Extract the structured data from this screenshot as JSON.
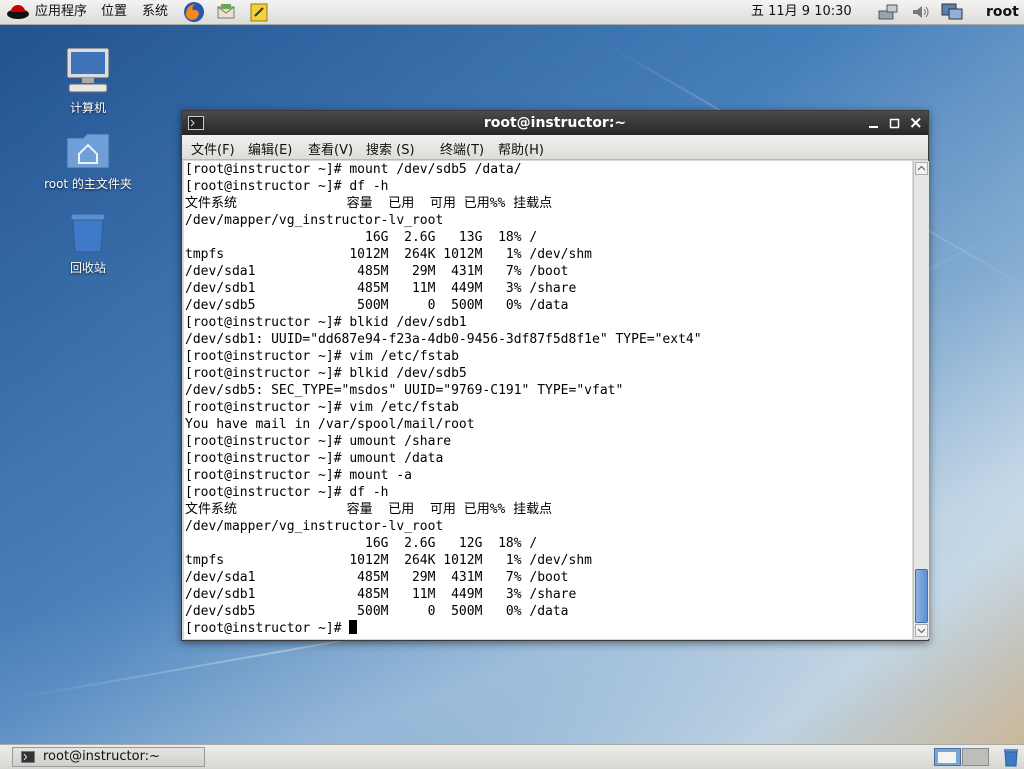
{
  "top_panel": {
    "applications": "应用程序",
    "places": "位置",
    "system": "系统",
    "clock": "五 11月  9 10:30",
    "user": "root"
  },
  "desktop": {
    "icons": [
      {
        "label": "计算机",
        "icon": "computer-icon"
      },
      {
        "label": "root 的主文件夹",
        "icon": "home-folder-icon"
      },
      {
        "label": "回收站",
        "icon": "trash-icon"
      }
    ]
  },
  "terminal": {
    "title": "root@instructor:~",
    "menu": [
      "文件(F)",
      "编辑(E)",
      "查看(V)",
      "搜索 (S)",
      "终端(T)",
      "帮助(H)"
    ],
    "lines": [
      "[root@instructor ~]# mount /dev/sdb5 /data/",
      "[root@instructor ~]# df -h",
      "文件系统              容量  已用  可用 已用%% 挂载点",
      "/dev/mapper/vg_instructor-lv_root",
      "                       16G  2.6G   13G  18% /",
      "tmpfs                1012M  264K 1012M   1% /dev/shm",
      "/dev/sda1             485M   29M  431M   7% /boot",
      "/dev/sdb1             485M   11M  449M   3% /share",
      "/dev/sdb5             500M     0  500M   0% /data",
      "[root@instructor ~]# blkid /dev/sdb1",
      "/dev/sdb1: UUID=\"dd687e94-f23a-4db0-9456-3df87f5d8f1e\" TYPE=\"ext4\"",
      "[root@instructor ~]# vim /etc/fstab",
      "[root@instructor ~]# blkid /dev/sdb5",
      "/dev/sdb5: SEC_TYPE=\"msdos\" UUID=\"9769-C191\" TYPE=\"vfat\"",
      "[root@instructor ~]# vim /etc/fstab",
      "You have mail in /var/spool/mail/root",
      "[root@instructor ~]# umount /share",
      "[root@instructor ~]# umount /data",
      "[root@instructor ~]# mount -a",
      "[root@instructor ~]# df -h",
      "文件系统              容量  已用  可用 已用%% 挂载点",
      "/dev/mapper/vg_instructor-lv_root",
      "                       16G  2.6G   12G  18% /",
      "tmpfs                1012M  264K 1012M   1% /dev/shm",
      "/dev/sda1             485M   29M  431M   7% /boot",
      "/dev/sdb1             485M   11M  449M   3% /share",
      "/dev/sdb5             500M     0  500M   0% /data"
    ],
    "prompt": "[root@instructor ~]# "
  },
  "taskbar": {
    "window_label": "root@instructor:~"
  }
}
